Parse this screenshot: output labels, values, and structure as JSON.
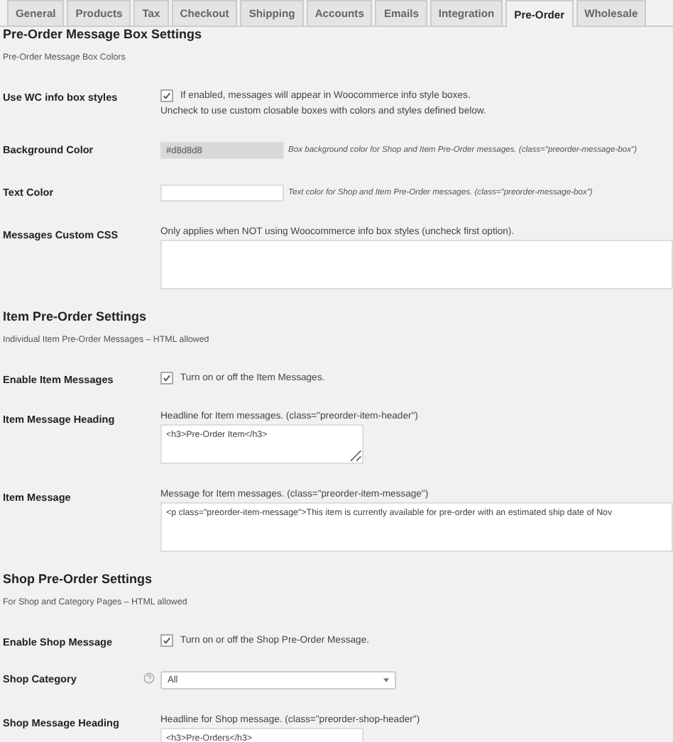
{
  "tabs": [
    {
      "label": "General",
      "selected": false
    },
    {
      "label": "Products",
      "selected": false
    },
    {
      "label": "Tax",
      "selected": false
    },
    {
      "label": "Checkout",
      "selected": false
    },
    {
      "label": "Shipping",
      "selected": false
    },
    {
      "label": "Accounts",
      "selected": false
    },
    {
      "label": "Emails",
      "selected": false
    },
    {
      "label": "Integration",
      "selected": false
    },
    {
      "label": "Pre-Order",
      "selected": true
    },
    {
      "label": "Wholesale",
      "selected": false
    }
  ],
  "sections": [
    {
      "title": "Pre-Order Message Box Settings",
      "subtitle": "Pre-Order Message Box Colors",
      "fields": [
        {
          "kind": "checkbox",
          "label": "Use WC info box styles",
          "checked": true,
          "description": "If enabled, messages will appear in Woocommerce info style boxes.",
          "note": "Uncheck to use custom closable boxes with colors and styles defined below."
        },
        {
          "kind": "color",
          "label": "Background Color",
          "value": "#d8d8d8",
          "description": "Box background color for Shop and Item Pre-Order messages. (class=\"preorder-message-box\")"
        },
        {
          "kind": "color",
          "label": "Text Color",
          "description": "Text color for Shop and Item Pre-Order messages. (class=\"preorder-message-box\")"
        },
        {
          "kind": "textarea",
          "label": "Messages Custom CSS",
          "hint": "Only applies when NOT using Woocommerce info box styles (uncheck first option)."
        }
      ]
    },
    {
      "title": "Item Pre-Order Settings",
      "subtitle": "Individual Item Pre-Order Messages – HTML allowed",
      "fields": [
        {
          "kind": "checkbox",
          "label": "Enable Item Messages",
          "checked": true,
          "description": "Turn on or off the Item Messages."
        },
        {
          "kind": "textbox",
          "label": "Item Message Heading",
          "hint": "Headline for Item messages. (class=\"preorder-item-header\")",
          "value": "<h3>Pre-Order Item</h3>"
        },
        {
          "kind": "textarea",
          "label": "Item Message",
          "hint": "Message for Item messages. (class=\"preorder-item-message\")",
          "value": "<p class=\"preorder-item-message\">This item is currently available for pre-order with an estimated ship date of Nov"
        }
      ]
    },
    {
      "title": "Shop Pre-Order Settings",
      "subtitle": "For Shop and Category Pages – HTML allowed",
      "fields": [
        {
          "kind": "checkbox",
          "label": "Enable Shop Message",
          "checked": true,
          "description": "Turn on or off the Shop Pre-Order Message."
        },
        {
          "kind": "select",
          "label": "Shop Category",
          "help": true,
          "value": "All"
        },
        {
          "kind": "textbox",
          "label": "Shop Message Heading",
          "hint": "Headline for Shop message. (class=\"preorder-shop-header\")",
          "value": "<h3>Pre-Orders</h3>"
        }
      ]
    }
  ]
}
